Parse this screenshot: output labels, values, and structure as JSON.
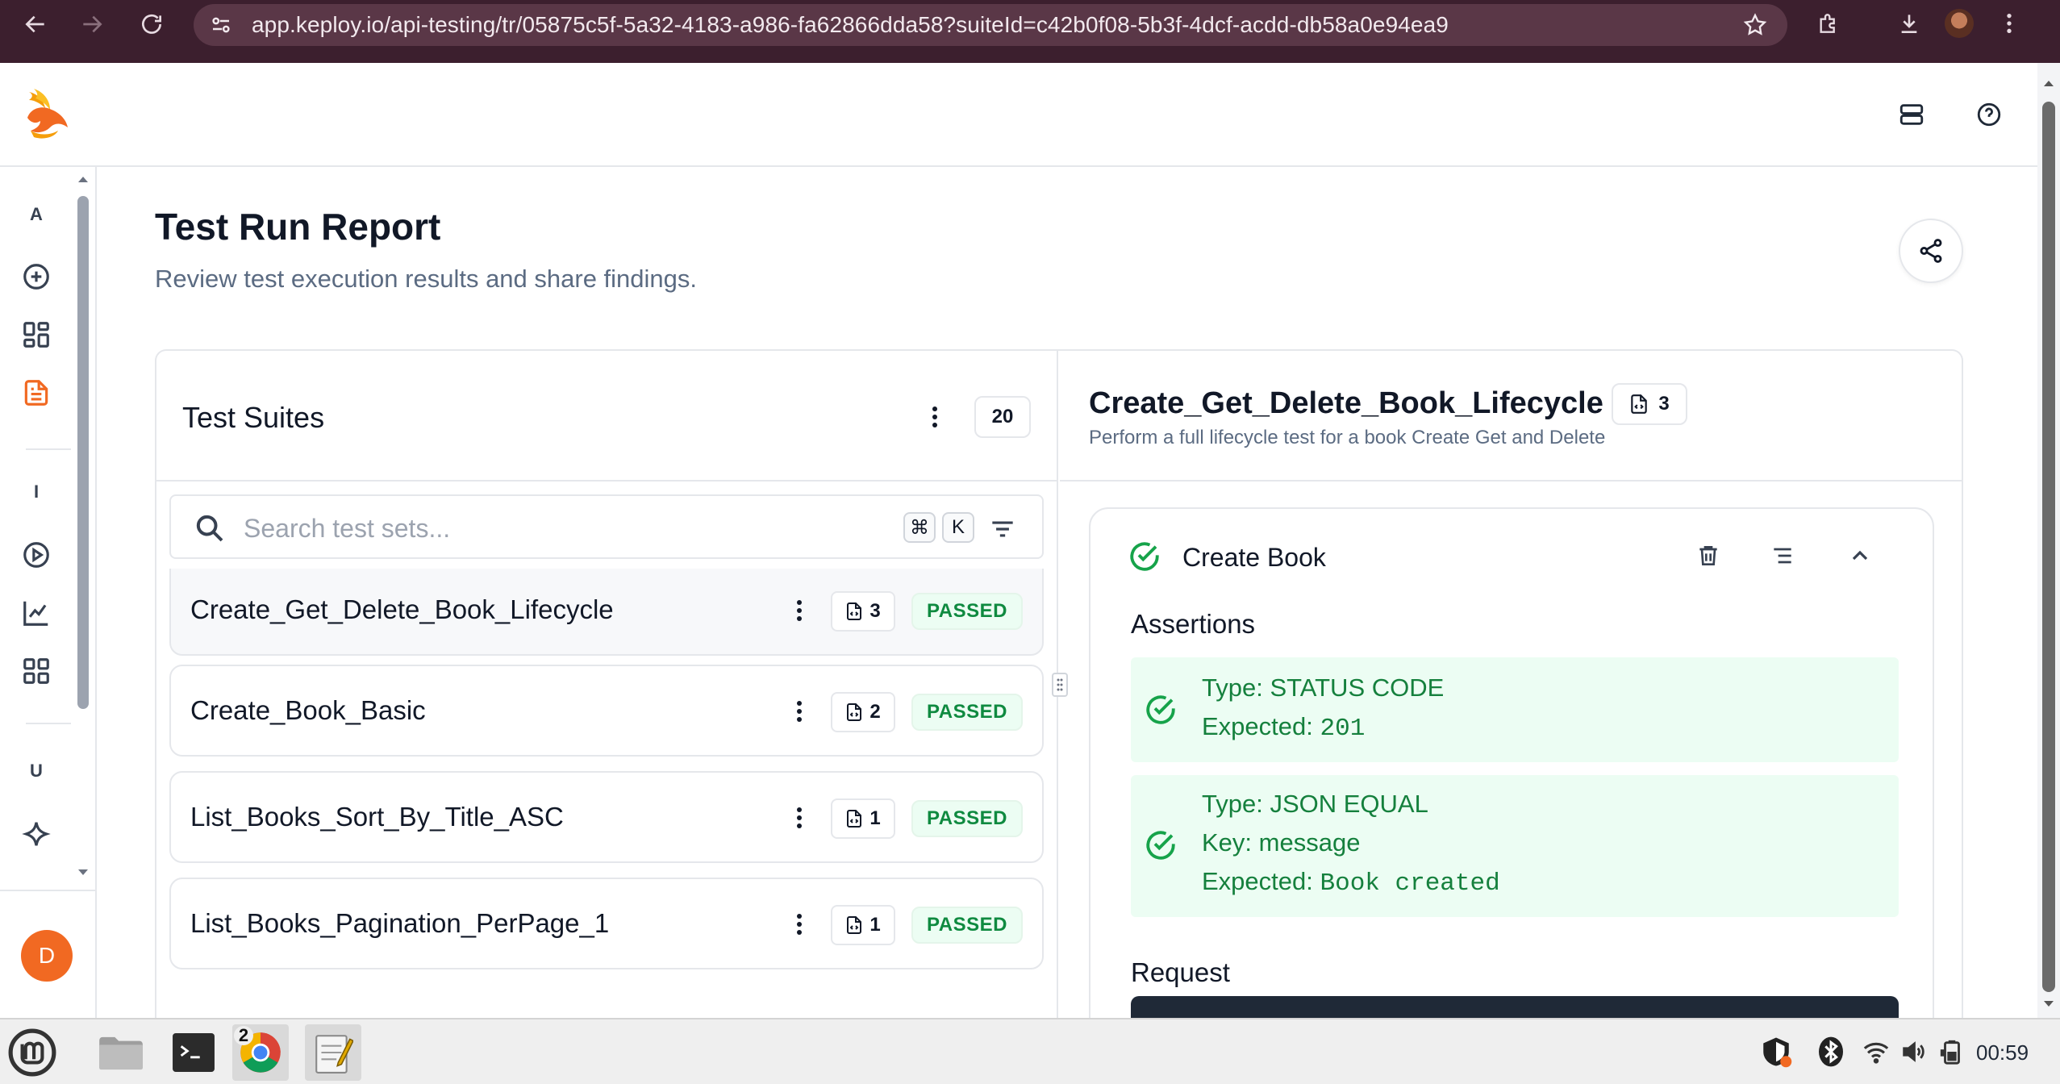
{
  "browser": {
    "url": "app.keploy.io/api-testing/tr/05875c5f-5a32-4183-a986-fa62866dda58?suiteId=c42b0f08-5b3f-4dcf-acdd-db58a0e94ea9"
  },
  "sidebar": {
    "section_a": "A",
    "section_i": "I",
    "section_u": "U",
    "avatar_initial": "D"
  },
  "page": {
    "title": "Test Run Report",
    "subtitle": "Review test execution results and share findings."
  },
  "suites_panel": {
    "title": "Test Suites",
    "count": "20",
    "search_placeholder": "Search test sets...",
    "kbd_cmd": "⌘",
    "kbd_k": "K",
    "items": [
      {
        "name": "Create_Get_Delete_Book_Lifecycle",
        "count": "3",
        "status": "PASSED"
      },
      {
        "name": "Create_Book_Basic",
        "count": "2",
        "status": "PASSED"
      },
      {
        "name": "List_Books_Sort_By_Title_ASC",
        "count": "1",
        "status": "PASSED"
      },
      {
        "name": "List_Books_Pagination_PerPage_1",
        "count": "1",
        "status": "PASSED"
      }
    ]
  },
  "detail": {
    "title": "Create_Get_Delete_Book_Lifecycle",
    "count": "3",
    "description": "Perform a full lifecycle test for a book Create Get and Delete",
    "test_case": {
      "title": "Create Book",
      "assertions_label": "Assertions",
      "assertions": [
        {
          "type_label": "Type: ",
          "type": "STATUS CODE",
          "expected_label": "Expected: ",
          "expected": "201"
        },
        {
          "type_label": "Type: ",
          "type": "JSON EQUAL",
          "key_label": "Key: ",
          "key": "message",
          "expected_label": "Expected: ",
          "expected": "Book created"
        }
      ],
      "request_label": "Request"
    }
  },
  "taskbar": {
    "chrome_badge": "2",
    "clock": "00:59"
  },
  "colors": {
    "brand_orange": "#f16922",
    "passed_green": "#0f8a40",
    "browser_bar": "#3c1f2e"
  }
}
